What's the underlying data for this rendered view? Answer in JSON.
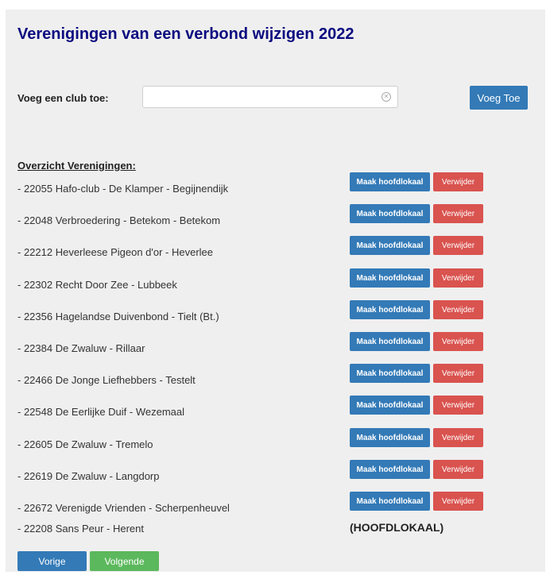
{
  "page": {
    "title": "Verenigingen van een verbond wijzigen 2022"
  },
  "add_club": {
    "label": "Voeg een club toe:",
    "input_value": "",
    "input_placeholder": "",
    "button_label": "Voeg Toe"
  },
  "overview": {
    "heading": "Overzicht Verenigingen:",
    "clubs": [
      {
        "name": "- 22055 Hafo-club - De Klamper - Begijnendijk"
      },
      {
        "name": "- 22048 Verbroedering - Betekom - Betekom"
      },
      {
        "name": "- 22212 Heverleese Pigeon d'or - Heverlee"
      },
      {
        "name": "- 22302 Recht Door Zee - Lubbeek"
      },
      {
        "name": "- 22356 Hagelandse Duivenbond - Tielt (Bt.)"
      },
      {
        "name": "- 22384 De Zwaluw - Rillaar"
      },
      {
        "name": "- 22466 De Jonge Liefhebbers - Testelt"
      },
      {
        "name": "- 22548 De Eerlijke Duif - Wezemaal"
      },
      {
        "name": "- 22605 De Zwaluw - Tremelo"
      },
      {
        "name": "- 22619 De Zwaluw - Langdorp"
      },
      {
        "name": "- 22672 Verenigde Vrienden - Scherpenheuvel"
      }
    ],
    "hq_button_label": "Maak hoofdlokaal",
    "delete_button_label": "Verwijder",
    "headquarters": {
      "name": "- 22208 Sans Peur - Herent",
      "label": "(HOOFDLOKAAL)"
    }
  },
  "navigation": {
    "prev_label": "Vorige",
    "next_label": "Volgende"
  },
  "colors": {
    "title": "#0c0c80",
    "panel_background": "#efefef",
    "primary_button": "#337ab7",
    "danger_button": "#d9534f",
    "success_button": "#5cb85c"
  },
  "icons": {
    "input_clear": "clear-circle-icon"
  }
}
